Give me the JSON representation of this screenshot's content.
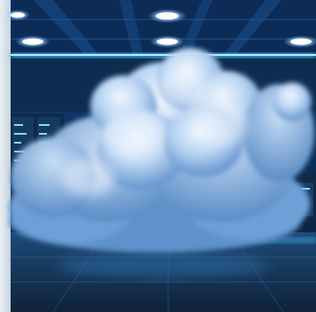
{
  "scene": {
    "subject": "cloud-in-server-room",
    "colors": {
      "ceiling": "#0b2a52",
      "ceiling_light": "#eaf6ff",
      "led_strip": "#39b8ff",
      "server_rack": "#0d2a44",
      "server_led": "#7fdcff",
      "cloud_shadow": "#4f86c4",
      "cloud_mid": "#9cc0e8",
      "cloud_highlight": "#e9f3ff",
      "floor": "#16304d",
      "floor_reflection": "#2a6ea8"
    }
  }
}
